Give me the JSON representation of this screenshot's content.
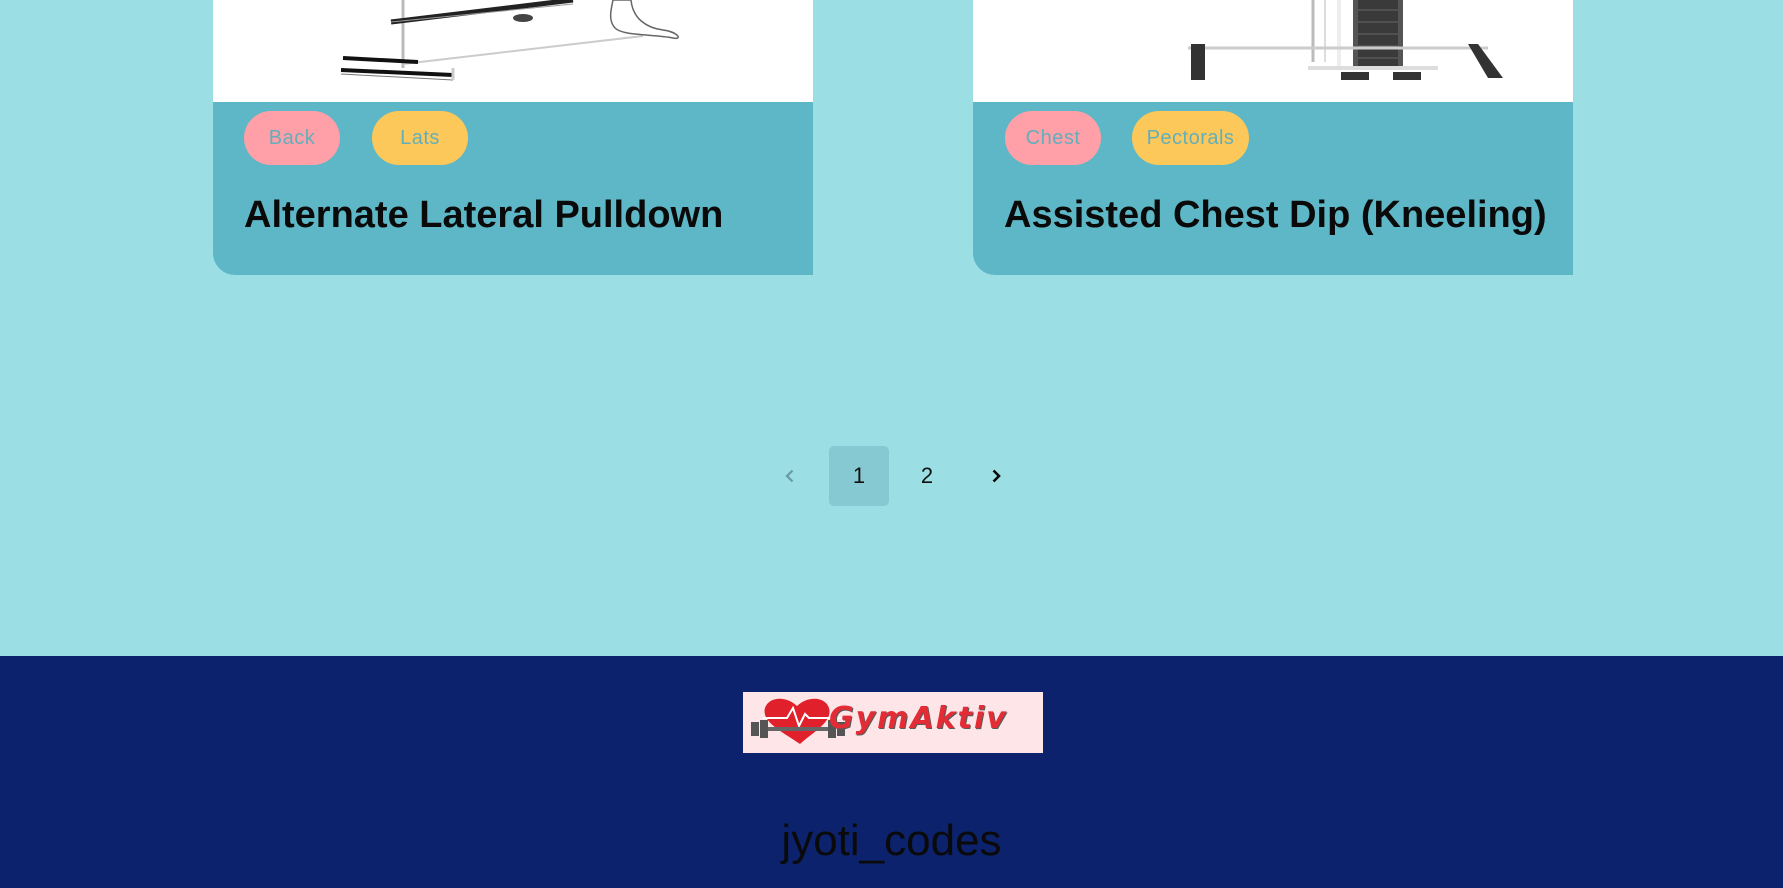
{
  "cards": [
    {
      "title": "Alternate Lateral Pulldown",
      "tags": [
        "Back",
        "Lats"
      ]
    },
    {
      "title": "Assisted Chest Dip (Kneeling)",
      "tags": [
        "Chest",
        "Pectorals"
      ]
    }
  ],
  "pagination": {
    "prev_icon": "chevron-left-icon",
    "pages": [
      "1",
      "2"
    ],
    "current": "1",
    "next_icon": "chevron-right-icon"
  },
  "footer": {
    "logo_text": "GymAktiv",
    "credit": "jyoti_codes"
  },
  "colors": {
    "background": "#9bdee4",
    "card": "#5eb7c6",
    "tag_pink": "#ffa0a8",
    "tag_yellow": "#fdc85a",
    "footer": "#0c226d"
  }
}
